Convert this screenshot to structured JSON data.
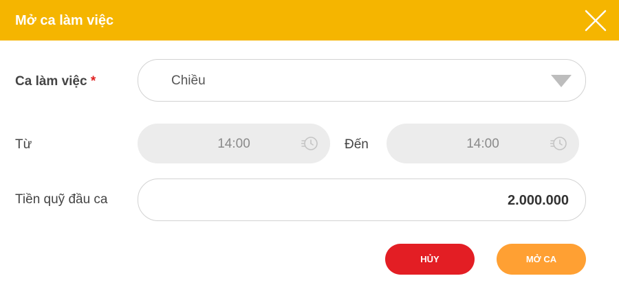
{
  "dialog": {
    "title": "Mở ca làm việc",
    "close_icon": "close-icon"
  },
  "shift": {
    "label": "Ca làm việc",
    "required_mark": "*",
    "selected": "Chiều"
  },
  "time": {
    "from_label": "Từ",
    "from_value": "14:00",
    "to_label": "Đến",
    "to_value": "14:00",
    "icon": "clock-icon"
  },
  "cash": {
    "label": "Tiền quỹ đầu ca",
    "value": "2.000.000"
  },
  "buttons": {
    "cancel_label": "HỦY",
    "open_label": "MỞ CA"
  },
  "colors": {
    "header": "#f5b500",
    "cancel": "#e31e24",
    "open": "#ffa033",
    "required": "#e02020"
  }
}
